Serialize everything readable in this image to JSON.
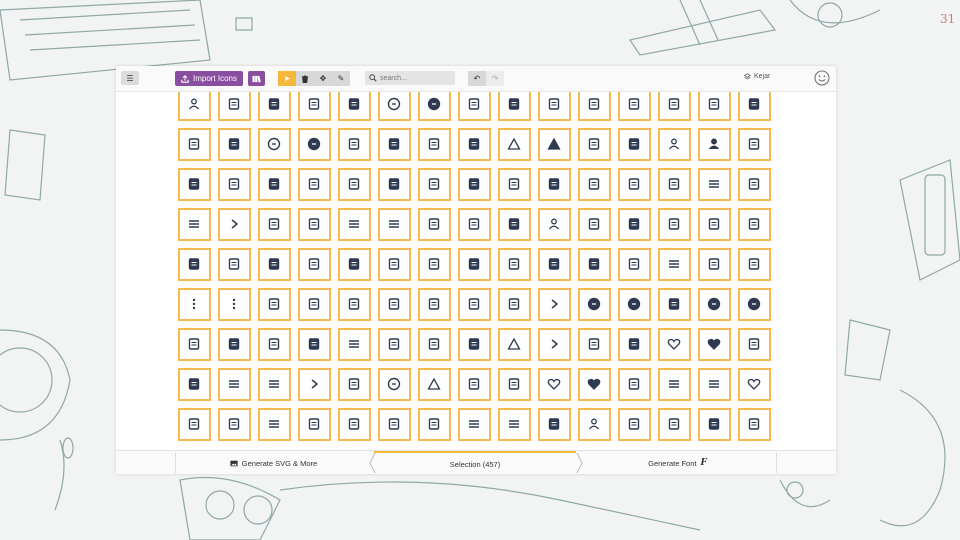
{
  "toolbar": {
    "import_label": "Import Icons",
    "search_placeholder": "search...",
    "user_label": "Kejar"
  },
  "footer": {
    "generate_svg": "Generate SVG & More",
    "selection": "Selection (457)",
    "generate_font": "Generate Font"
  },
  "decor": {
    "corner_mark": "31"
  },
  "colors": {
    "accent": "#8a4ea0",
    "tool_active": "#f6b83c",
    "cell_border": "#f6b950",
    "icon_fill": "#2e3a4f"
  },
  "icons": [
    "user-card",
    "bank",
    "bank-filled",
    "shield-badge",
    "star-badge-filled",
    "pencil-circle",
    "pencil-circle-filled",
    "note",
    "note-filled",
    "lock",
    "clipboard",
    "pause",
    "image-box",
    "box-open",
    "book-filled",
    "book-box",
    "book-open-filled",
    "question-circle",
    "question-circle-filled",
    "signpost",
    "signpost-filled",
    "id-card",
    "id-card-filled",
    "flag-triangle",
    "flag-triangle-filled",
    "gear",
    "gear-filled",
    "user-gear",
    "user-gear-filled",
    "megaphone",
    "megaphone-filled",
    "badge-gear",
    "star-shield-filled",
    "trophy",
    "mail",
    "mail-filled",
    "map",
    "map-filled",
    "org-chart",
    "org-chart-filled",
    "phone",
    "image",
    "shapes",
    "list-check",
    "checkbox-down",
    "list",
    "play",
    "podium",
    "award",
    "list-box",
    "document-list",
    "devices",
    "printer",
    "lock-filled",
    "user",
    "pie-chart",
    "pie-chart-filled",
    "globe",
    "upload",
    "bookmark",
    "bookmark-filled",
    "shield-check",
    "shield-check-filled",
    "folder",
    "folder-filled",
    "gamepad",
    "game-device",
    "game-device-filled",
    "dice",
    "dice-filled",
    "gamepad-filled",
    "medal",
    "grid-list",
    "arrows-horizontal",
    "arrows-vertical",
    "dots-vertical",
    "dots-vertical-2",
    "stamp",
    "folder-export",
    "document-add",
    "document-plus",
    "document-new",
    "folder-add",
    "text-add",
    "fast-forward",
    "star-circle-filled",
    "lightning-circle-filled",
    "ball-filled",
    "download-circle-filled",
    "upload-circle-filled",
    "calendar-star",
    "calendar-star-filled",
    "bell",
    "bell-filled",
    "list-ordered",
    "tag-outline",
    "window",
    "window-filled",
    "warning",
    "chevrons-right",
    "document-star",
    "document-star-filled",
    "chat-heart",
    "chat-heart-filled",
    "puzzle",
    "puzzle-filled",
    "chat-lines",
    "chat-lines-filled",
    "chevron-left",
    "apps",
    "number-1-circle",
    "warning-triangle",
    "number-3-box",
    "pentagon",
    "heart",
    "heart-filled",
    "newspaper",
    "hamburger",
    "menu-filled",
    "heart-chat",
    "map-pin",
    "calendar",
    "text-lines",
    "sign-out",
    "hook",
    "fingerprint",
    "music-note",
    "align-left",
    "align-left-filled",
    "music-note-filled",
    "person",
    "keyboard",
    "tray",
    "tray-filled",
    "save"
  ]
}
